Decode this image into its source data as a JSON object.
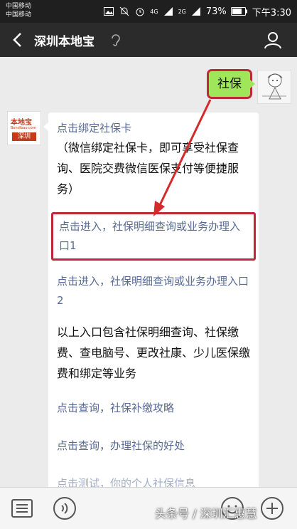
{
  "status": {
    "carrier1": "中国移动",
    "carrier2": "中国移动",
    "battery": "73%",
    "time": "下午3:30",
    "net1": "4G",
    "net2": "2G"
  },
  "header": {
    "title": "深圳本地宝"
  },
  "chat": {
    "user_message": "社保",
    "bot_avatar": {
      "line1": "本地宝",
      "line2": "Bendibao.com",
      "line3": "深圳"
    },
    "bot_message": {
      "link1": "点击绑定社保卡",
      "text1": "（微信绑定社保卡，即可享受社保查询、医院交费微信医保支付等便捷服务）",
      "link2": "点击进入，社保明细查询或业务办理入口1",
      "link3": "点击进入，社保明细查询或业务办理入口2",
      "text2": "以上入口包含社保明细查询、社保缴费、查电脑号、更改社康、少儿医保缴费和绑定等业务",
      "link4": "点击查询，社保补缴攻略",
      "link5": "点击查询，办理社保的好处",
      "link6_partial": "点击测试，你的个人社保信息"
    }
  },
  "watermark": "头条号 / 深圳汇惠慧",
  "colors": {
    "accent_link": "#576b95",
    "user_bubble": "#9fe65a",
    "highlight_red": "#c0283a"
  }
}
